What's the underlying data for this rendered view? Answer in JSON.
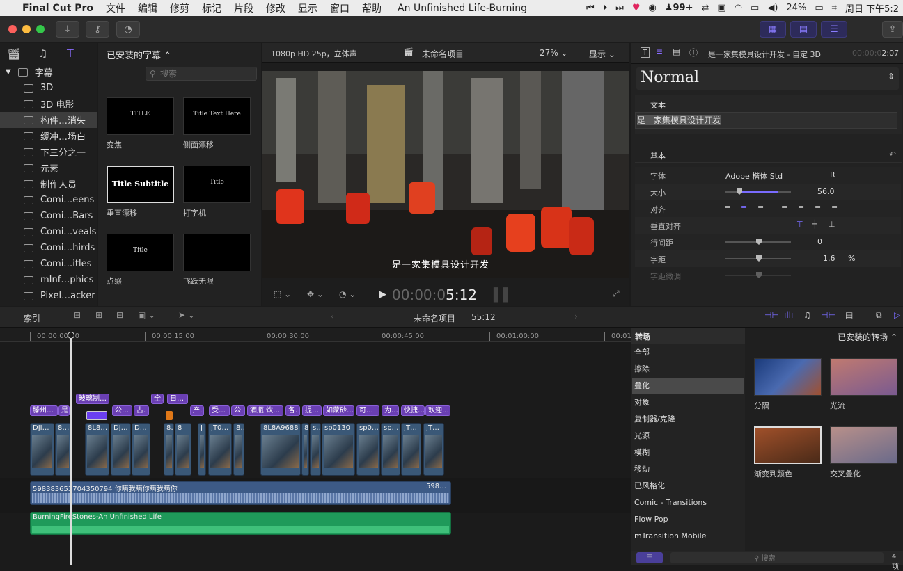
{
  "menubar": {
    "app": "Final Cut Pro",
    "menus": [
      "文件",
      "编辑",
      "修剪",
      "标记",
      "片段",
      "修改",
      "显示",
      "窗口",
      "帮助"
    ],
    "now_playing": "An Unfinished Life-Burning",
    "notif": "99+",
    "battery": "24%",
    "clock": "周日 下午5:2"
  },
  "browser": {
    "sidebar_root": "字幕",
    "sidebar_items": [
      "3D",
      "3D 电影",
      "构件…消失",
      "缓冲…场白",
      "下三分之一",
      "元素",
      "制作人员",
      "Comi…eens",
      "Comi…Bars",
      "Comi…veals",
      "Comi…hirds",
      "Comi…itles",
      "mInf…phics",
      "Pixel…acker"
    ],
    "header": "已安装的字幕",
    "search_placeholder": "搜索",
    "thumbs": [
      {
        "label": "变焦",
        "text": "TITLE"
      },
      {
        "label": "侧面漂移",
        "text": "Title Text Here"
      },
      {
        "label": "垂直漂移",
        "text": "Title Subtitle"
      },
      {
        "label": "打字机",
        "text": "Title"
      },
      {
        "label": "点缀",
        "text": "Title"
      },
      {
        "label": "飞跃无限",
        "text": ""
      }
    ]
  },
  "viewer": {
    "format": "1080p HD 25p，立体声",
    "project": "未命名项目",
    "zoom": "27%",
    "view_menu": "显示",
    "caption": "是一家集模具设计开发",
    "timecode_dim": "00:00:0",
    "timecode": "5:12"
  },
  "inspector": {
    "title": "是一家集模具设计开发 - 自定 3D",
    "time_dim": "00:00:0",
    "time": "2:07",
    "preset": "Normal",
    "text_section": "文本",
    "text_value": "是一家集模具设计开发",
    "basic_section": "基本",
    "rows": [
      {
        "label": "字体",
        "value": "Adobe 楷体 Std",
        "extra": "R"
      },
      {
        "label": "大小",
        "value": "56.0"
      },
      {
        "label": "对齐",
        "value": ""
      },
      {
        "label": "垂直对齐",
        "value": ""
      },
      {
        "label": "行间距",
        "value": "0"
      },
      {
        "label": "字距",
        "value": "1.6",
        "unit": "%"
      },
      {
        "label": "字距微调",
        "value": ""
      }
    ]
  },
  "timeline": {
    "index_tab": "索引",
    "project": "未命名项目",
    "duration": "55:12",
    "ruler": [
      "00:00:00:00",
      "00:00:15:00",
      "00:00:30:00",
      "00:00:45:00",
      "00:01:00:00",
      "00:01:"
    ],
    "titles_upper": [
      "玻璃制…",
      "全.",
      "日…"
    ],
    "titles_lower": [
      "滕州…",
      "是",
      "公…",
      "占.",
      "产…",
      "受…",
      "公.",
      "酒瓶 饮…",
      "各.",
      "提…",
      "如蒙砂…",
      "可…",
      "为…",
      "快捷…",
      "欢迎…"
    ],
    "clips": [
      "DJI…",
      "8…",
      "8L8…",
      "DJ…",
      "D…",
      "8…",
      "8",
      "J",
      "JT0…",
      "8…",
      "8L8A9688",
      "8",
      "s…",
      "sp0130",
      "sp0…",
      "sp…",
      "JT…",
      "JT…"
    ],
    "audio_label": "598383653704350794 你瞒我瞒你瞒我瞒你",
    "audio_label2": "598…",
    "music_label": "BurningFireStones-An Unfinished Life"
  },
  "transitions": {
    "header_left": "转场",
    "header_right": "已安装的转场",
    "categories": [
      "全部",
      "擦除",
      "叠化",
      "对象",
      "复制器/克隆",
      "光源",
      "模糊",
      "移动",
      "已风格化",
      "Comic - Transitions",
      "Flow Pop",
      "mTransition Mobile"
    ],
    "selected": "叠化",
    "items": [
      "分隔",
      "光流",
      "渐变到颜色",
      "交叉叠化"
    ],
    "search_placeholder": "搜索",
    "count": "4 项"
  },
  "colors": {
    "accent": "#6a3fb3",
    "video": "#3a5877",
    "audio": "#3d5a86",
    "music": "#1f9a5a"
  }
}
